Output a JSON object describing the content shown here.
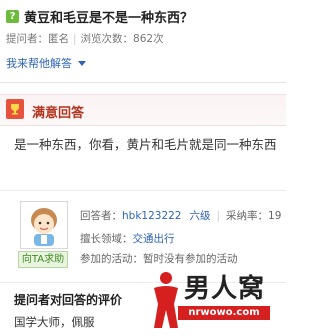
{
  "question": {
    "badge": "?",
    "title": "黄豆和毛豆是不是一种东西？",
    "asker_label": "提问者：",
    "asker_name": "匿名",
    "views_label": "浏览次数：",
    "views_value": "862次"
  },
  "help_link": "我来帮他解答",
  "best_answer": {
    "title": "满意回答",
    "text": "是一种东西，你看，黄片和毛片就是同一种东西"
  },
  "answerer": {
    "name_label": "回答者：",
    "name": "hbk123222",
    "level": "六级",
    "adopt_rate_label": "采纳率：",
    "adopt_rate_value": "19",
    "specialty_label": "擅长领域：",
    "specialty_value": "交通出行",
    "activity_label": "参加的活动：",
    "activity_value": "暂时没有参加的活动",
    "help_button": "向TA求助"
  },
  "evaluation": {
    "title": "提问者对回答的评价",
    "text": "国学大师，佩服"
  },
  "watermark": {
    "name": "男人窝",
    "url": "nrwowo.com"
  },
  "colors": {
    "link": "#2d64b3",
    "badge_green": "#6cbb3c",
    "best_red": "#b3341f",
    "watermark_red": "#d6201f"
  }
}
